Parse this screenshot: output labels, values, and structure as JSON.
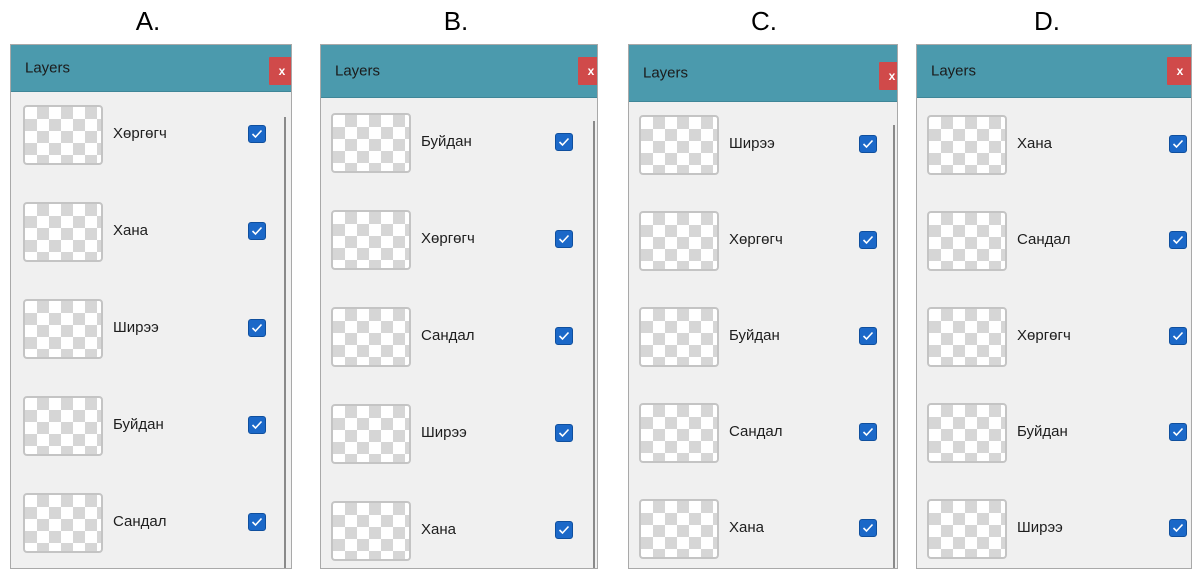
{
  "options": [
    {
      "letter": "A.",
      "title": "Layers",
      "close_label": "x",
      "layers": [
        {
          "name": "Хөргөгч",
          "visible": true
        },
        {
          "name": "Хана",
          "visible": true
        },
        {
          "name": "Ширээ",
          "visible": true
        },
        {
          "name": "Буйдан",
          "visible": true
        },
        {
          "name": "Сандал",
          "visible": true
        }
      ]
    },
    {
      "letter": "B.",
      "title": "Layers",
      "close_label": "x",
      "layers": [
        {
          "name": "Буйдан",
          "visible": true
        },
        {
          "name": "Хөргөгч",
          "visible": true
        },
        {
          "name": "Сандал",
          "visible": true
        },
        {
          "name": "Ширээ",
          "visible": true
        },
        {
          "name": "Хана",
          "visible": true
        }
      ]
    },
    {
      "letter": "C.",
      "title": "Layers",
      "close_label": "x",
      "layers": [
        {
          "name": "Ширээ",
          "visible": true
        },
        {
          "name": "Хөргөгч",
          "visible": true
        },
        {
          "name": "Буйдан",
          "visible": true
        },
        {
          "name": "Сандал",
          "visible": true
        },
        {
          "name": "Хана",
          "visible": true
        }
      ]
    },
    {
      "letter": "D.",
      "title": "Layers",
      "close_label": "x",
      "layers": [
        {
          "name": "Хана",
          "visible": true
        },
        {
          "name": "Сандал",
          "visible": true
        },
        {
          "name": "Хөргөгч",
          "visible": true
        },
        {
          "name": "Буйдан",
          "visible": true
        },
        {
          "name": "Ширээ",
          "visible": true
        }
      ]
    }
  ],
  "colors": {
    "titlebar": "#4b9aad",
    "close_button": "#d04a4a",
    "checkbox": "#1b68c8",
    "panel_background": "#f0f0f0"
  },
  "icons": {
    "close": "close-icon",
    "thumbnail": "transparent-thumbnail-icon",
    "checkbox": "checkmark-icon"
  }
}
